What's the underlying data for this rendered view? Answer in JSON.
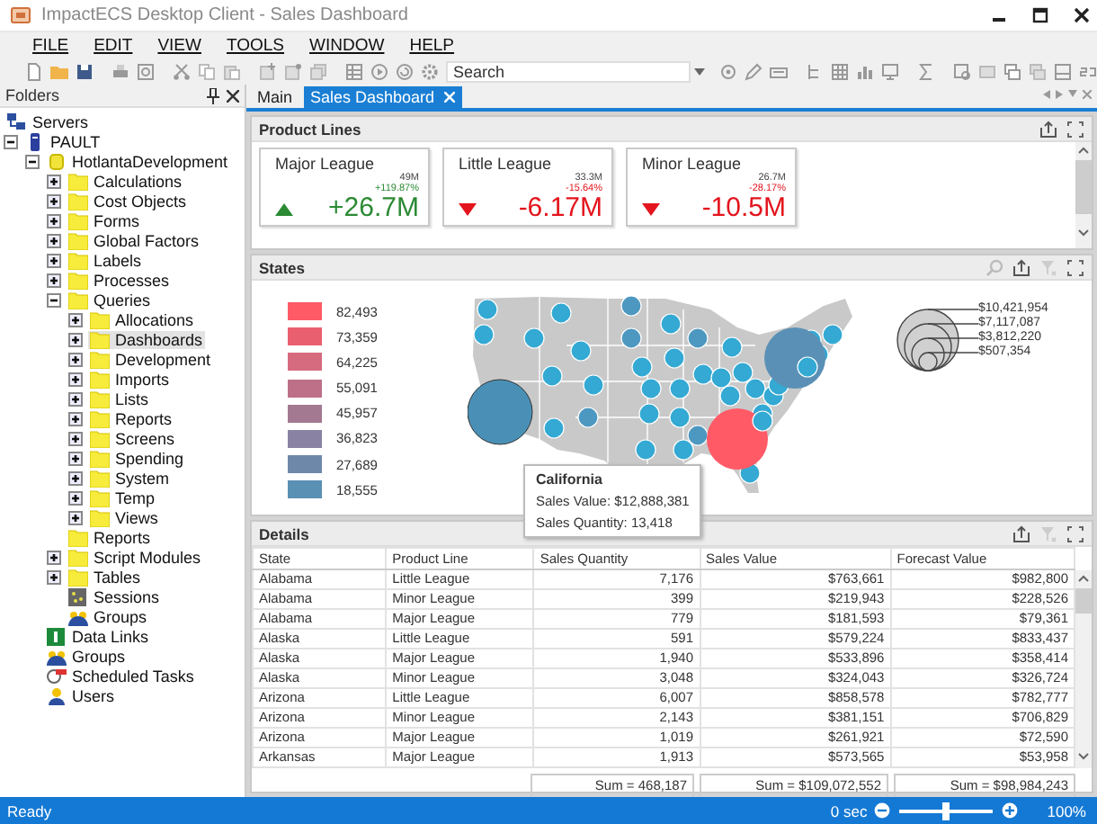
{
  "window": {
    "title": "ImpactECS Desktop Client - Sales Dashboard"
  },
  "menu": [
    "FILE",
    "EDIT",
    "VIEW",
    "TOOLS",
    "WINDOW",
    "HELP"
  ],
  "toolbar": {
    "search": {
      "placeholder": "Search"
    }
  },
  "folders": {
    "title": "Folders",
    "tree": [
      {
        "label": "Servers",
        "kind": "servers",
        "selected": false,
        "children": [
          {
            "label": "PAULT",
            "kind": "server",
            "expanded": true,
            "selected": false,
            "children": [
              {
                "label": "HotlantaDevelopment",
                "kind": "database",
                "expanded": true,
                "selected": false,
                "children": [
                  {
                    "label": "Calculations",
                    "kind": "folder",
                    "expanded": false,
                    "selected": false
                  },
                  {
                    "label": "Cost Objects",
                    "kind": "folder",
                    "expanded": false,
                    "selected": false
                  },
                  {
                    "label": "Forms",
                    "kind": "folder",
                    "expanded": false,
                    "selected": false
                  },
                  {
                    "label": "Global Factors",
                    "kind": "folder",
                    "expanded": false,
                    "selected": false
                  },
                  {
                    "label": "Labels",
                    "kind": "folder",
                    "expanded": false,
                    "selected": false
                  },
                  {
                    "label": "Processes",
                    "kind": "folder",
                    "expanded": false,
                    "selected": false
                  },
                  {
                    "label": "Queries",
                    "kind": "folder",
                    "expanded": true,
                    "selected": false,
                    "children": [
                      {
                        "label": "Allocations",
                        "kind": "folder",
                        "expanded": false,
                        "selected": false
                      },
                      {
                        "label": "Dashboards",
                        "kind": "folder",
                        "expanded": false,
                        "selected": true
                      },
                      {
                        "label": "Development",
                        "kind": "folder",
                        "expanded": false,
                        "selected": false
                      },
                      {
                        "label": "Imports",
                        "kind": "folder",
                        "expanded": false,
                        "selected": false
                      },
                      {
                        "label": "Lists",
                        "kind": "folder",
                        "expanded": false,
                        "selected": false
                      },
                      {
                        "label": "Reports",
                        "kind": "folder",
                        "expanded": false,
                        "selected": false
                      },
                      {
                        "label": "Screens",
                        "kind": "folder",
                        "expanded": false,
                        "selected": false
                      },
                      {
                        "label": "Spending",
                        "kind": "folder",
                        "expanded": false,
                        "selected": false
                      },
                      {
                        "label": "System",
                        "kind": "folder",
                        "expanded": false,
                        "selected": false
                      },
                      {
                        "label": "Temp",
                        "kind": "folder",
                        "expanded": false,
                        "selected": false
                      },
                      {
                        "label": "Views",
                        "kind": "folder",
                        "expanded": false,
                        "selected": false
                      }
                    ]
                  },
                  {
                    "label": "Reports",
                    "kind": "folder",
                    "selected": false
                  },
                  {
                    "label": "Script Modules",
                    "kind": "folder",
                    "expanded": false,
                    "selected": false
                  },
                  {
                    "label": "Tables",
                    "kind": "folder",
                    "expanded": false,
                    "selected": false
                  },
                  {
                    "label": "Sessions",
                    "kind": "sessions",
                    "selected": false
                  },
                  {
                    "label": "Groups",
                    "kind": "groups",
                    "selected": false
                  }
                ]
              },
              {
                "label": "Data Links",
                "kind": "datalink",
                "selected": false
              },
              {
                "label": "Groups",
                "kind": "groups",
                "selected": false
              },
              {
                "label": "Scheduled Tasks",
                "kind": "schedule",
                "selected": false
              },
              {
                "label": "Users",
                "kind": "users",
                "selected": false
              }
            ]
          }
        ]
      }
    ]
  },
  "tabs": [
    {
      "label": "Main",
      "selected": false
    },
    {
      "label": "Sales Dashboard",
      "selected": true
    }
  ],
  "product_lines": {
    "title": "Product Lines",
    "cards": [
      {
        "title": "Major League",
        "target": "49M",
        "delta": "+119.87%",
        "value": "+26.7M",
        "kind": "up"
      },
      {
        "title": "Little League",
        "target": "33.3M",
        "delta": "-15.64%",
        "value": "-6.17M",
        "kind": "down"
      },
      {
        "title": "Minor League",
        "target": "26.7M",
        "delta": "-28.17%",
        "value": "-10.5M",
        "kind": "down"
      }
    ]
  },
  "states": {
    "title": "States",
    "legend": [
      {
        "value": "82,493",
        "color": "#ff5a66"
      },
      {
        "value": "73,359",
        "color": "#ea5f6f"
      },
      {
        "value": "64,225",
        "color": "#d66a7e"
      },
      {
        "value": "55,091",
        "color": "#bd7088"
      },
      {
        "value": "45,957",
        "color": "#a37891"
      },
      {
        "value": "36,823",
        "color": "#8a82a2"
      },
      {
        "value": "27,689",
        "color": "#6e88aa"
      },
      {
        "value": "18,555",
        "color": "#5a90b4"
      }
    ],
    "size_legend": [
      "$10,421,954",
      "$7,117,087",
      "$3,812,220",
      "$507,354"
    ],
    "tooltip": {
      "title": "California",
      "lines": [
        "Sales Value: $12,888,381",
        "Sales Quantity: 13,418"
      ]
    }
  },
  "details": {
    "title": "Details",
    "columns": [
      "State",
      "Product Line",
      "Sales Quantity",
      "Sales Value",
      "Forecast Value"
    ],
    "rows": [
      [
        "Alabama",
        "Little League",
        "7,176",
        "$763,661",
        "$982,800"
      ],
      [
        "Alabama",
        "Minor League",
        "399",
        "$219,943",
        "$228,526"
      ],
      [
        "Alabama",
        "Major League",
        "779",
        "$181,593",
        "$79,361"
      ],
      [
        "Alaska",
        "Little League",
        "591",
        "$579,224",
        "$833,437"
      ],
      [
        "Alaska",
        "Major League",
        "1,940",
        "$533,896",
        "$358,414"
      ],
      [
        "Alaska",
        "Minor League",
        "3,048",
        "$324,043",
        "$326,724"
      ],
      [
        "Arizona",
        "Little League",
        "6,007",
        "$858,578",
        "$782,777"
      ],
      [
        "Arizona",
        "Minor League",
        "2,143",
        "$381,151",
        "$706,829"
      ],
      [
        "Arizona",
        "Major League",
        "1,019",
        "$261,921",
        "$72,590"
      ],
      [
        "Arkansas",
        "Major League",
        "1,913",
        "$573,565",
        "$53,958"
      ]
    ],
    "totals": [
      "Sum = 468,187",
      "Sum = $109,072,552",
      "Sum = $98,984,243"
    ]
  },
  "status_bar": {
    "text": "Ready",
    "time": "0 sec",
    "zoom": {
      "level": 0.5,
      "reading": "100%"
    }
  }
}
